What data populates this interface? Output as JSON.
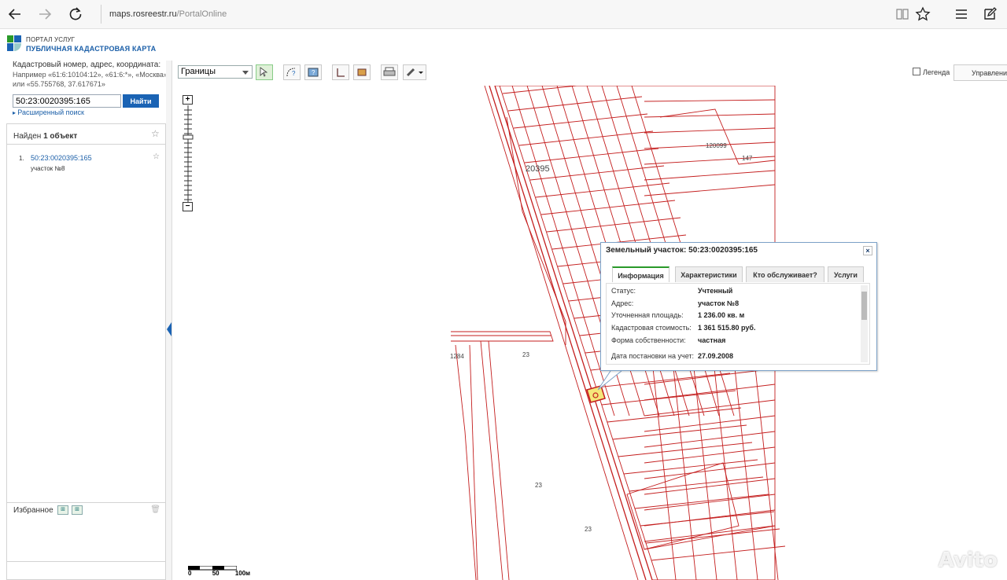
{
  "browser": {
    "url_host": "maps.rosreestr.ru",
    "url_path": "/PortalOnline"
  },
  "portal": {
    "top_label": "ПОРТАЛ УСЛУГ",
    "title": "ПУБЛИЧНАЯ КАДАСТРОВАЯ КАРТА"
  },
  "search": {
    "hint": "Кадастровый номер, адрес, координата:",
    "example": "Например «61:6:10104:12», «61:6:*», «Москва» или «55.755768, 37.617671»",
    "value": "50:23:0020395:165",
    "button": "Найти",
    "advanced": "Расширенный поиск"
  },
  "results": {
    "found_prefix": "Найден",
    "found_count": "1 объект",
    "items": [
      {
        "num": "1.",
        "link": "50:23:0020395:165",
        "sub": "участок №8"
      }
    ]
  },
  "favorites": {
    "title": "Избранное"
  },
  "toolbar": {
    "layer": "Границы",
    "legend": "Легенда",
    "manage": "Управление"
  },
  "map": {
    "block_label": "20395",
    "scale": [
      "0",
      "50",
      "100м"
    ],
    "lot_numbers": [
      {
        "t": "23"
      },
      {
        "t": "23"
      },
      {
        "t": "23"
      },
      {
        "t": "1284"
      },
      {
        "t": "120099"
      },
      {
        "t": "147"
      }
    ]
  },
  "popup": {
    "title": "Земельный участок: 50:23:0020395:165",
    "tabs": [
      "Информация",
      "Характеристики",
      "Кто обслуживает?",
      "Услуги"
    ],
    "rows": [
      {
        "label": "Статус:",
        "value": "Учтенный"
      },
      {
        "label": "Адрес:",
        "value": "участок №8"
      },
      {
        "label": "Уточненная площадь:",
        "value": "1 236.00 кв. м"
      },
      {
        "label": "Кадастровая стоимость:",
        "value": "1 361 515.80 руб."
      },
      {
        "label": "Форма собственности:",
        "value": "частная"
      },
      {
        "label": "Дата постановки на учет:",
        "value": "27.09.2008"
      }
    ]
  },
  "watermark": "Avito",
  "colors": {
    "boundary": "#c41e1e",
    "accent": "#1a63b4",
    "selected": "#f5e67a"
  }
}
